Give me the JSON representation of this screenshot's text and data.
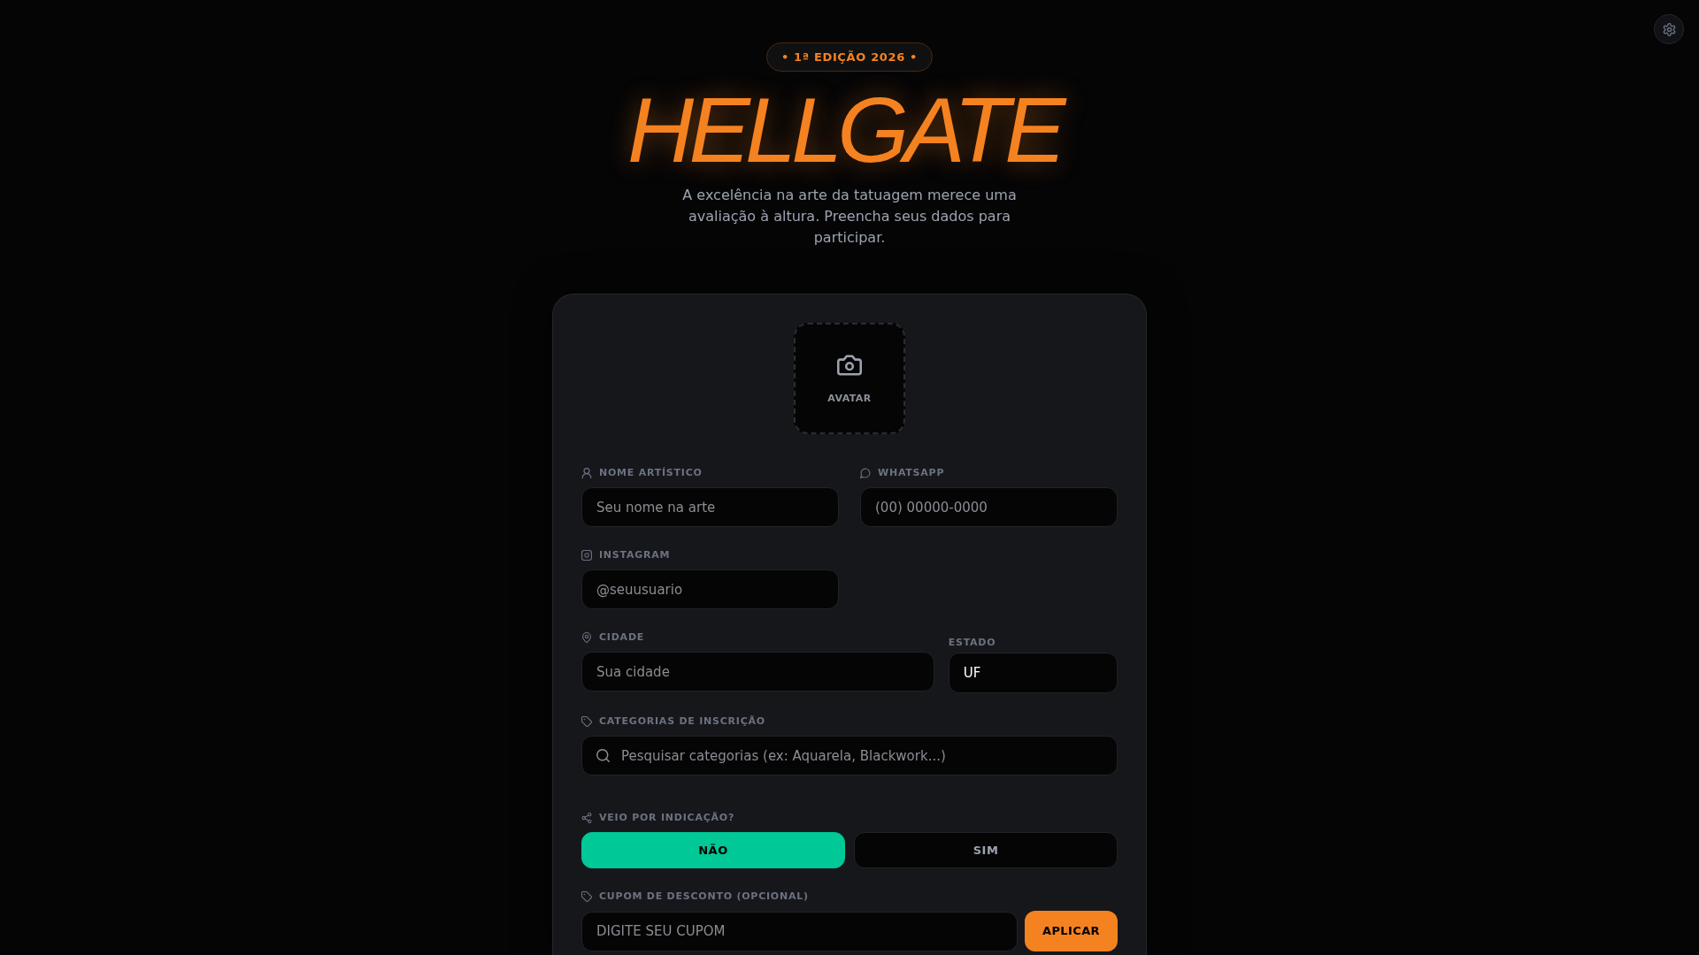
{
  "header": {
    "badge": "• 1ª EDIÇÃO 2026 •",
    "title": "HELLGATE",
    "subtitle": "A excelência na arte da tatuagem merece uma avaliação à altura. Preencha seus dados para participar."
  },
  "form": {
    "avatar_upload": {
      "label": "AVATAR"
    },
    "artist_name": {
      "label": "NOME ARTÍSTICO",
      "placeholder": "Seu nome na arte"
    },
    "whatsapp": {
      "label": "WHATSAPP",
      "placeholder": "(00) 00000-0000"
    },
    "instagram": {
      "label": "INSTAGRAM",
      "placeholder": "@seuusuario"
    },
    "city": {
      "label": "CIDADE",
      "placeholder": "Sua cidade"
    },
    "state": {
      "label": "ESTADO",
      "value": "UF"
    },
    "categories": {
      "label": "CATEGORIAS DE INSCRIÇÃO",
      "placeholder": "Pesquisar categorias (ex: Aquarela, Blackwork...)"
    },
    "referral": {
      "label": "VEIO POR INDICAÇÃO?",
      "options": [
        {
          "label": "NÃO",
          "selected": true
        },
        {
          "label": "SIM",
          "selected": false
        }
      ]
    },
    "coupon": {
      "label": "CUPOM DE DESCONTO (OPCIONAL)",
      "placeholder": "DIGITE SEU CUPOM",
      "button": "APLICAR"
    }
  }
}
